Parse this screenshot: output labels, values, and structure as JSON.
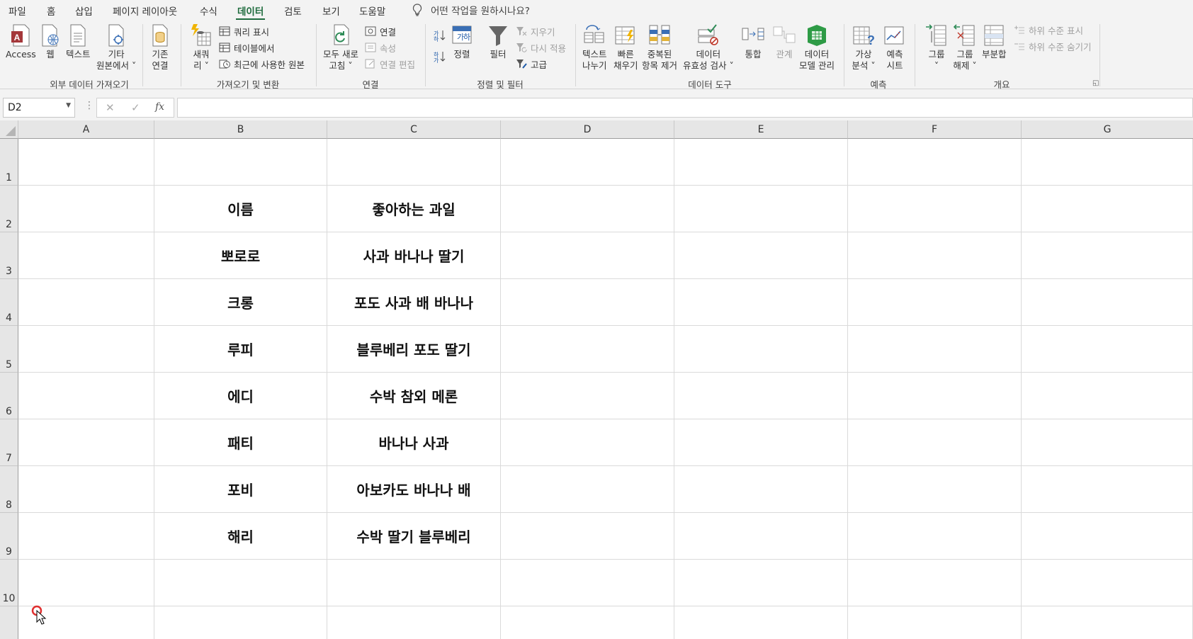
{
  "tabs": [
    {
      "label": "파일",
      "active": false
    },
    {
      "label": "홈",
      "active": false
    },
    {
      "label": "삽입",
      "active": false
    },
    {
      "label": "페이지 레이아웃",
      "active": false
    },
    {
      "label": "수식",
      "active": false
    },
    {
      "label": "데이터",
      "active": true
    },
    {
      "label": "검토",
      "active": false
    },
    {
      "label": "보기",
      "active": false
    },
    {
      "label": "도움말",
      "active": false
    }
  ],
  "tell_me": "어떤 작업을 원하시나요?",
  "ribbon": {
    "groups": {
      "get_external": "외부 데이터 가져오기",
      "get_transform": "가져오기 및 변환",
      "connections": "연결",
      "sort_filter": "정렬 및 필터",
      "data_tools": "데이터 도구",
      "forecast": "예측",
      "outline": "개요"
    },
    "buttons": {
      "access": "Access",
      "web": "웹",
      "text": "텍스트",
      "other_sources": "기타\n원본에서 ˅",
      "existing_conn": "기존\n연결",
      "new_query": "새쿼\n리 ˅",
      "show_queries": "쿼리 표시",
      "from_table": "테이블에서",
      "recent_sources": "최근에 사용한 원본",
      "refresh_all": "모두 새로\n고침 ˅",
      "connections": "연결",
      "properties": "속성",
      "edit_links": "연결 편집",
      "sort": "정렬",
      "filter": "필터",
      "clear": "지우기",
      "reapply": "다시 적용",
      "advanced": "고급",
      "text_to_columns": "텍스트\n나누기",
      "flash_fill": "빠른\n채우기",
      "remove_duplicates": "중복된\n항목 제거",
      "data_validation": "데이터\n유효성 검사 ˅",
      "consolidate": "통합",
      "relationships": "관계",
      "data_model": "데이터\n모델 관리",
      "what_if": "가상\n분석 ˅",
      "forecast_sheet": "예측\n시트",
      "group": "그룹\n˅",
      "ungroup": "그룹\n해제 ˅",
      "subtotal": "부분합",
      "show_detail": "하위 수준 표시",
      "hide_detail": "하위 수준 숨기기"
    }
  },
  "formula_bar": {
    "name_box": "D2",
    "fx": "fx",
    "cancel": "✕",
    "enter": "✓",
    "value": ""
  },
  "columns": [
    "A",
    "B",
    "C",
    "D",
    "E",
    "F",
    "G"
  ],
  "rows": [
    "1",
    "2",
    "3",
    "4",
    "5",
    "6",
    "7",
    "8",
    "9",
    "10",
    ""
  ],
  "table": {
    "header": [
      "이름",
      "좋아하는 과일"
    ],
    "rows": [
      [
        "뽀로로",
        "사과 바나나 딸기"
      ],
      [
        "크롱",
        "포도 사과 배 바나나"
      ],
      [
        "루피",
        "블루베리 포도 딸기"
      ],
      [
        "에디",
        "수박 참외 메론"
      ],
      [
        "패티",
        "바나나 사과"
      ],
      [
        "포비",
        "아보카도 바나나 배"
      ],
      [
        "해리",
        "수박 딸기 블루베리"
      ]
    ]
  },
  "accent_color": "#1e6b3d"
}
